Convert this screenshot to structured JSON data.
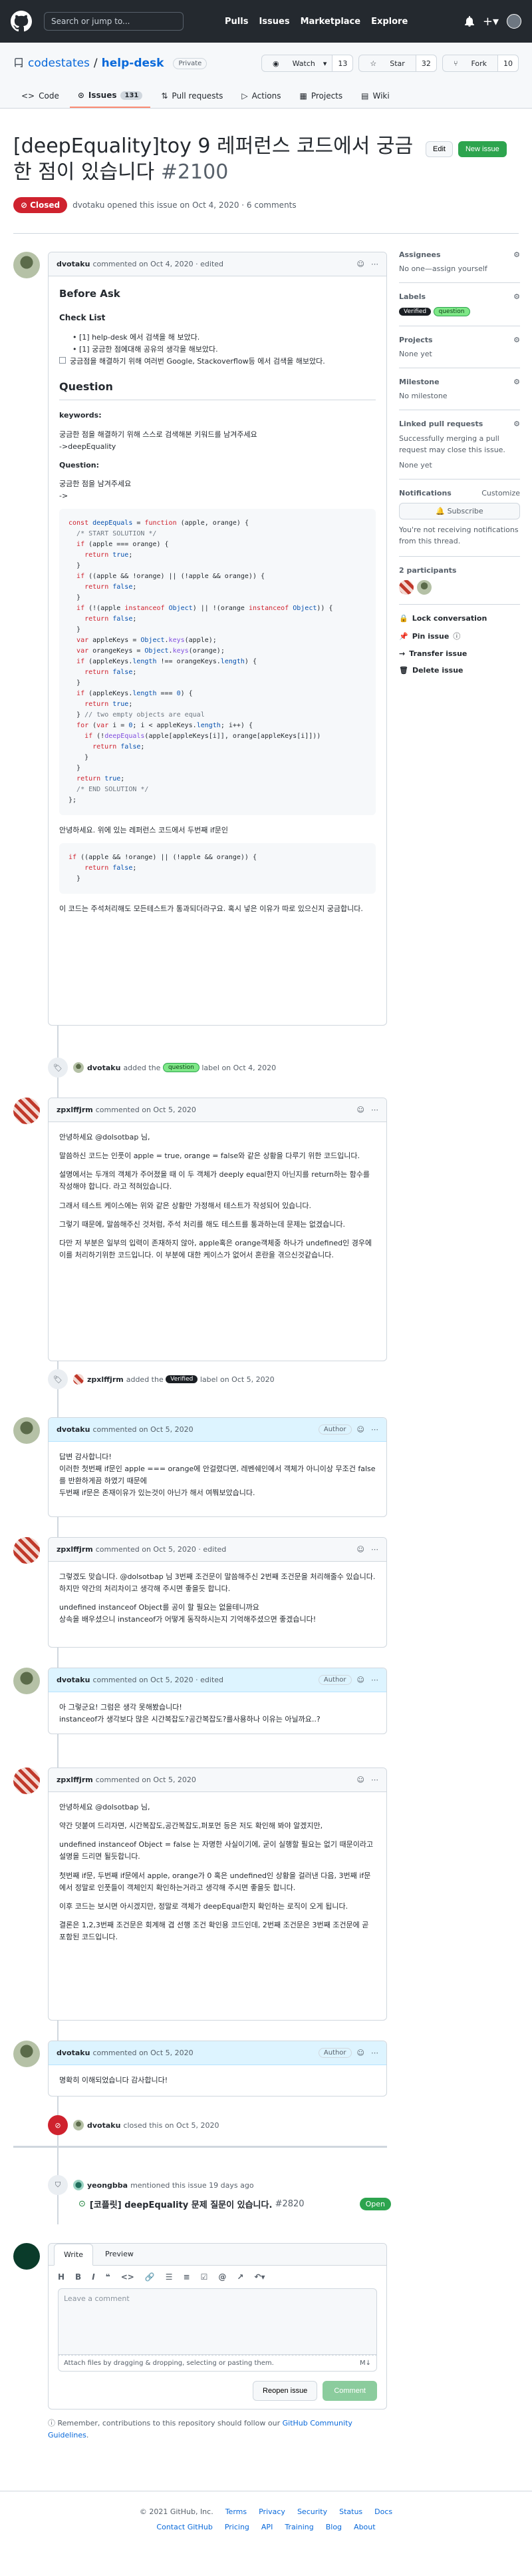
{
  "header": {
    "search_placeholder": "Search or jump to...",
    "nav": [
      "Pulls",
      "Issues",
      "Marketplace",
      "Explore"
    ]
  },
  "repo": {
    "owner": "codestates",
    "name": "help-desk",
    "visibility": "Private",
    "watch": "Watch",
    "watch_count": "13",
    "star": "Star",
    "star_count": "32",
    "fork": "Fork",
    "fork_count": "10"
  },
  "tabs": [
    {
      "label": "Code"
    },
    {
      "label": "Issues",
      "count": "131"
    },
    {
      "label": "Pull requests"
    },
    {
      "label": "Actions"
    },
    {
      "label": "Projects"
    },
    {
      "label": "Wiki"
    }
  ],
  "issue": {
    "title": "[deepEquality]toy 9 레퍼런스 코드에서 궁금한 점이 있습니다",
    "number": "#2100",
    "edit": "Edit",
    "new_issue": "New issue",
    "state": "Closed",
    "meta": "dvotaku opened this issue on Oct 4, 2020 · 6 comments"
  },
  "first_comment": {
    "author": "dvotaku",
    "meta": "commented on Oct 4, 2020 · edited",
    "h_before": "Before Ask",
    "h_check": "Check List",
    "checks": [
      "[1] help-desk 에서 검색을 해 보았다.",
      "[1] 궁금한 점에대해 공유의 생각을 해보았다.",
      "궁금점을 해결하기 위해 여러번 Google, Stackoverflow등 에서 검색을 해보았다."
    ],
    "h_question": "Question",
    "kw_label": "keywords:",
    "kw_text": "궁금한 점을 해결하기 위해 스스로 검색해본 키워드를 남겨주세요",
    "kw_value": "->deepEquality",
    "q_label": "Question:",
    "q_text": "궁금한 점을 남겨주세요",
    "q_arrow": "->",
    "after_text": "안녕하세요. 위에 있는 레퍼런스 코드에서 두번째 if문인",
    "closing": "이 코드는 주석처리해도 모든테스트가 통과되더라구요. 혹시 넣은 이유가 따로 있으신지 궁금합니다."
  },
  "label_event_1": {
    "author": "dvotaku",
    "pre": "added the",
    "label": "question",
    "post": "label on Oct 4, 2020"
  },
  "comment2": {
    "author": "zpxlffjrm",
    "meta": "commented on Oct 5, 2020",
    "paras": [
      "안녕하세요 @dolsotbap 님,",
      "말씀하신 코드는 인풋이 apple = true, orange = false와 같은 상황을 다루기 위한 코드입니다.",
      "설명에서는 두개의 객체가 주어졌을 때 이 두 객체가 deeply equal한지 아닌지를 return하는 함수를 작성해야 합니다. 라고 적혀있습니다.",
      "그래서 테스트 케이스에는 위와 같은 상황만 가정해서 테스트가 작성되어 있습니다.",
      "그렇기 때문에, 말씀해주신 것처럼, 주석 처리를 해도 테스트를 통과하는데 문제는 없겠습니다.",
      "다만 저 부분은 일부의 입력이 존재하지 않아, apple혹은 orange객체중 하나가 undefined인 경우에 이를 처리하기위한 코드입니다. 이 부분에 대한 케이스가 없어서 혼란을 겪으신것같습니다."
    ]
  },
  "label_event_2": {
    "author": "zpxlffjrm",
    "pre": "added the",
    "label": "Verified",
    "post": "label on Oct 5, 2020"
  },
  "comment3": {
    "author": "dvotaku",
    "meta": "commented on Oct 5, 2020",
    "role": "Author",
    "paras": [
      "답변 감사합니다!",
      "이러한 첫번째 if문인 apple === orange에 안걸렸다면, 레벤쉐인에서 객체가 아니이상 무조건 false를 반환하게끔 하였기 때문에",
      "두번째 if문은 존재이유가 있는것이 아닌가 해서 여쭤보았습니다."
    ]
  },
  "comment4": {
    "author": "zpxlffjrm",
    "meta": "commented on Oct 5, 2020 · edited",
    "paras": [
      "그렇겠도 맞습니다. @dolsotbap 님 3번째 조건문이 말씀해주신 2번째 조건문을 처리해줄수 있습니다. 하지만 약간의 처리차이고 생각해 주시면 좋을듯 합니다.",
      "undefined instanceof Object를 공이 할 필요는 없을테니까요",
      "상속을 배우셨으니 instanceof가 어떻게 동작하시는지 기억해주셨으면 좋겠습니다!"
    ]
  },
  "comment5": {
    "author": "dvotaku",
    "meta": "commented on Oct 5, 2020 · edited",
    "role": "Author",
    "paras": [
      "아 그렇군요! 그럼은 생각 못해봤습니다!",
      "instanceof가 생각보다 많은 시간복잡도?공간복잡도?를사용하나 이유는 아닐까요..?"
    ]
  },
  "comment6": {
    "author": "zpxlffjrm",
    "meta": "commented on Oct 5, 2020",
    "paras": [
      "안녕하세요 @dolsotbap 님,",
      "약간 덧붙여 드리자면, 시간복잡도,공간복잡도,퍼포먼 등은 저도 확인해 봐야 알겠지만,",
      "undefined instanceof Object = false 는 자명한 사실이기에, 굳이 실행할 필요는 없기 때문이라고 설명을 드리면 될듯합니다.",
      "첫번째 if문, 두번째 if문에서 apple, orange가 0 혹은 undefined인 상황을 걸러낸 다음, 3번째 if문에서 정말로 인풋들이 객체인지 확인하는거라고 생각해 주시면 좋을듯 합니다.",
      "이후 코드는 보시면 아시겠지만, 정말로 객체가 deepEqual한지 확인하는 로직이 오게 됩니다.",
      "결론은 1,2,3번째 조건문은 회계해 겹 선행 조건 확인용 코드인데, 2번째 조건문은 3번째 조건문에 곧 포함된 코드입니다."
    ]
  },
  "comment7": {
    "author": "dvotaku",
    "meta": "commented on Oct 5, 2020",
    "role": "Author",
    "paras": [
      "명확히 이해되었습니다 감사합니다!"
    ]
  },
  "close_event": {
    "author": "dvotaku",
    "text": "closed this on Oct 5, 2020"
  },
  "mention": {
    "author": "yeongbba",
    "text": "mentioned this issue 19 days ago",
    "link_title": "[코플릿] deepEquality 문제 질문이 있습니다.",
    "link_num": "#2820",
    "state": "Open"
  },
  "editor": {
    "tab_write": "Write",
    "tab_preview": "Preview",
    "placeholder": "Leave a comment",
    "attach": "Attach files by dragging & dropping, selecting or pasting them.",
    "reopen": "Reopen issue",
    "comment": "Comment",
    "note_pre": "Remember, contributions to this repository should follow our",
    "note_link": "GitHub Community Guidelines",
    "note_post": "."
  },
  "sidebar": {
    "assignees_h": "Assignees",
    "assignees_v": "No one—assign yourself",
    "labels_h": "Labels",
    "labels": [
      "Verified",
      "question"
    ],
    "projects_h": "Projects",
    "projects_v": "None yet",
    "milestone_h": "Milestone",
    "milestone_v": "No milestone",
    "linked_h": "Linked pull requests",
    "linked_v": "Successfully merging a pull request may close this issue.",
    "linked_v2": "None yet",
    "notif_h": "Notifications",
    "notif_customize": "Customize",
    "subscribe": "Subscribe",
    "notif_v": "You're not receiving notifications from this thread.",
    "participants_h": "2 participants",
    "actions": [
      "Lock conversation",
      "Pin issue",
      "Transfer issue",
      "Delete issue"
    ]
  },
  "footer": {
    "copyright": "© 2021 GitHub, Inc.",
    "row1": [
      "Terms",
      "Privacy",
      "Security",
      "Status",
      "Docs"
    ],
    "row2": [
      "Contact GitHub",
      "Pricing",
      "API",
      "Training",
      "Blog",
      "About"
    ]
  }
}
